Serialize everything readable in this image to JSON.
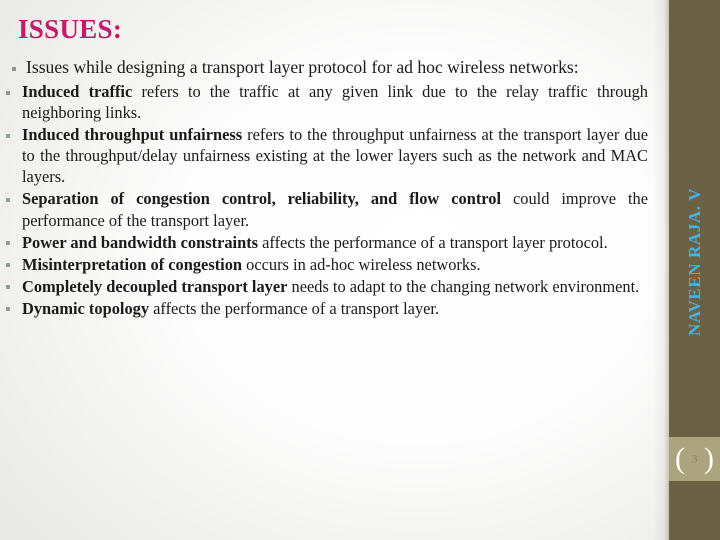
{
  "slide": {
    "title": "ISSUES:",
    "title_color": "#C31A6B",
    "background_color": "#FFFFFF"
  },
  "sidebar": {
    "background_color": "#6B6245",
    "author": "NAVEEN RAJA. V",
    "author_color": "#44B4E2",
    "badge": {
      "background_color": "#ACA37F",
      "left_bracket": "(",
      "right_bracket": ")",
      "page_number": "3"
    }
  },
  "content": {
    "intro": {
      "text": "Issues while designing a transport layer protocol for ad hoc wireless networks:"
    },
    "items": [
      {
        "bold": "Induced traffic",
        "rest": " refers to the traffic at any given link due to the relay traffic through neighboring links."
      },
      {
        "bold": "Induced throughput unfairness",
        "rest": " refers to the throughput unfairness at the transport layer due to the throughput/delay unfairness existing at the lower layers such as the network and MAC layers."
      },
      {
        "bold": "Separation of congestion control, reliability, and flow control",
        "rest": " could improve the performance of the transport layer."
      },
      {
        "bold": "Power and bandwidth constraints",
        "rest": " affects the performance of a transport layer protocol."
      },
      {
        "bold": "Misinterpretation of congestion",
        "rest": " occurs in ad-hoc wireless networks."
      },
      {
        "bold": "Completely decoupled transport layer",
        "rest": " needs to adapt to the changing network environment."
      },
      {
        "bold": "Dynamic topology",
        "rest": " affects the performance of a transport layer."
      }
    ]
  }
}
